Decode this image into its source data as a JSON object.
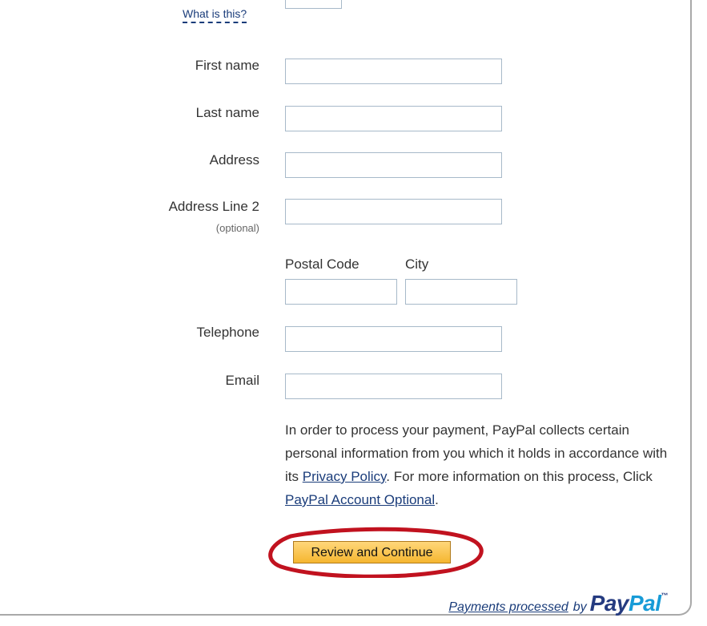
{
  "help": {
    "what_is_this": "What is this?"
  },
  "form": {
    "first_name_label": "First name",
    "last_name_label": "Last name",
    "address_label": "Address",
    "address2_label": "Address Line 2",
    "address2_optional": "(optional)",
    "postal_code_label": "Postal Code",
    "city_label": "City",
    "telephone_label": "Telephone",
    "email_label": "Email",
    "first_name_value": "",
    "last_name_value": "",
    "address_value": "",
    "address2_value": "",
    "postal_code_value": "",
    "city_value": "",
    "telephone_value": "",
    "email_value": ""
  },
  "info": {
    "text_1": "In order to process your payment, PayPal collects certain personal information from you which it holds in accordance with its ",
    "privacy_link": "Privacy Policy",
    "text_2": ". For more information on this process, Click ",
    "account_optional_link": "PayPal Account Optional",
    "text_3": "."
  },
  "actions": {
    "review_button": "Review and Continue"
  },
  "footer": {
    "payments_processed": "Payments processed",
    "by": "by",
    "logo_pay": "Pay",
    "logo_pal": "Pal",
    "logo_tm": "™"
  },
  "colors": {
    "link": "#1a3c7a",
    "button_top": "#ffd77a",
    "button_bottom": "#f5b630",
    "annotation_oval": "#c1121f",
    "paypal_dark": "#253b80",
    "paypal_light": "#179bd7"
  }
}
